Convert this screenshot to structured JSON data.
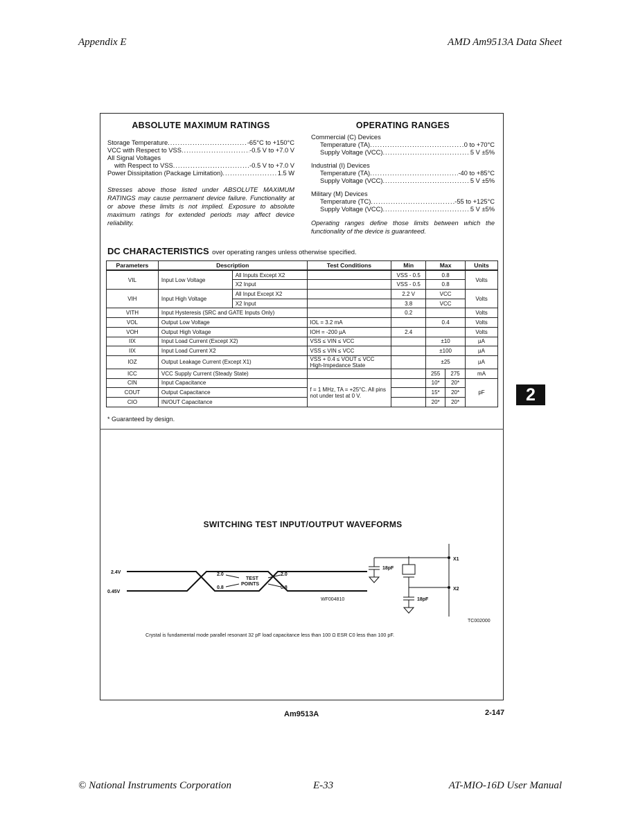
{
  "header": {
    "left": "Appendix E",
    "right": "AMD Am9513A Data Sheet"
  },
  "abs_max": {
    "title": "ABSOLUTE MAXIMUM RATINGS",
    "items": [
      {
        "label": "Storage Temperature",
        "value": "-65°C to +150°C"
      },
      {
        "label": "VCC with Respect to VSS",
        "value": "-0.5 V to +7.0 V"
      },
      {
        "label": "All Signal Voltages",
        "value": ""
      },
      {
        "label": "with Respect to VSS",
        "value": "-0.5 V to +7.0 V"
      },
      {
        "label": "Power Dissipitation (Package Limitation)",
        "value": "1.5 W"
      }
    ],
    "note": "Stresses above those listed under ABSOLUTE MAXIMUM RATINGS may cause permanent device failure. Functionality at or above these limits is not implied. Exposure to absolute maximum ratings for extended periods may affect device reliability."
  },
  "op_ranges": {
    "title": "OPERATING RANGES",
    "groups": [
      {
        "name": "Commercial (C) Devices",
        "temp_label": "Temperature (TA)",
        "temp": "0 to +70°C",
        "supply_label": "Supply Voltage (VCC)",
        "supply": "5 V ±5%"
      },
      {
        "name": "Industrial (I) Devices",
        "temp_label": "Temperature (TA)",
        "temp": "-40 to +85°C",
        "supply_label": "Supply Voltage (VCC)",
        "supply": "5 V ±5%"
      },
      {
        "name": "Military (M) Devices",
        "temp_label": "Temperature (TC)",
        "temp": "-55 to +125°C",
        "supply_label": "Supply Voltage (VCC)",
        "supply": "5 V ±5%"
      }
    ],
    "note": "Operating ranges define those limits between which the functionality of the device is guaranteed."
  },
  "dc": {
    "title": "DC CHARACTERISTICS",
    "subtitle": "over operating ranges unless otherwise specified.",
    "columns": [
      "Parameters",
      "Description",
      "Test Conditions",
      "Min",
      "Max",
      "Units"
    ],
    "rows": [
      {
        "param": "VIL",
        "desc": "Input Low Voltage",
        "sub": [
          "All Inputs Except X2",
          "X2 Input"
        ],
        "cond": [
          "",
          ""
        ],
        "min": [
          "VSS - 0.5",
          "VSS - 0.5"
        ],
        "max": [
          "0.8",
          "0.8"
        ],
        "units": "Volts"
      },
      {
        "param": "VIH",
        "desc": "Input High Voltage",
        "sub": [
          "All Input Except X2",
          "X2 Input"
        ],
        "cond": [
          "",
          ""
        ],
        "min": [
          "2.2 V",
          "3.8"
        ],
        "max": [
          "VCC",
          "VCC"
        ],
        "units": "Volts"
      },
      {
        "param": "VITH",
        "desc": "Input Hysteresis (SRC and GATE Inputs Only)",
        "cond": "",
        "min": "0.2",
        "max": "",
        "units": "Volts"
      },
      {
        "param": "VOL",
        "desc": "Output Low Voltage",
        "cond": "IOL = 3.2 mA",
        "min": "",
        "max": "0.4",
        "units": "Volts"
      },
      {
        "param": "VOH",
        "desc": "Output High Voltage",
        "cond": "IOH = -200 µA",
        "min": "2.4",
        "max": "",
        "units": "Volts"
      },
      {
        "param": "IIX",
        "desc": "Input Load Current (Except X2)",
        "cond": "VSS ≤ VIN ≤ VCC",
        "min": "",
        "max": "±10",
        "units": "µA"
      },
      {
        "param": "IIX",
        "desc": "Input Load Current X2",
        "cond": "VSS ≤ VIN ≤ VCC",
        "min": "",
        "max": "±100",
        "units": "µA"
      },
      {
        "param": "IOZ",
        "desc": "Output Leakage Current (Except X1)",
        "cond": "VSS + 0.4 ≤ VOUT ≤ VCC High-Impedance State",
        "min": "",
        "max": "±25",
        "units": "µA"
      },
      {
        "param": "ICC",
        "desc": "VCC Supply Current (Steady State)",
        "cond": "",
        "min": "",
        "max": [
          "255",
          "275"
        ],
        "units": "mA"
      }
    ],
    "cap_rows": [
      {
        "param": "CIN",
        "desc": "Input Capacitance",
        "max": [
          "10*",
          "20*"
        ]
      },
      {
        "param": "COUT",
        "desc": "Output Capacitance",
        "max": [
          "15*",
          "20*"
        ]
      },
      {
        "param": "CIO",
        "desc": "IN/OUT Capacitance",
        "max": [
          "20*",
          "20*"
        ]
      }
    ],
    "cap_cond": "f = 1 MHz, TA = +25°C. All pins not under test at 0 V.",
    "cap_units": "pF",
    "footnote": "* Guaranteed by design."
  },
  "waveforms": {
    "title": "SWITCHING TEST INPUT/OUTPUT WAVEFORMS",
    "v_high": "2.4V",
    "v_low": "0.45V",
    "tp_high": "2.0",
    "tp_low": "0.8",
    "test": "TEST",
    "points": "POINTS",
    "fig_id": "WF004810",
    "cap1": "18pF",
    "cap2": "18pF",
    "x1": "X1",
    "x2": "X2",
    "circuit_id": "TC002000",
    "caption": "Crystal is fundamental mode parallel resonant 32 pF load capacitance less than 100 Ω ESR C0 less than 100 pF."
  },
  "page_footer": {
    "part": "Am9513A",
    "page": "2-147"
  },
  "section_tab": "2",
  "footer": {
    "left": "© National Instruments Corporation",
    "center": "E-33",
    "right": "AT-MIO-16D User Manual"
  }
}
